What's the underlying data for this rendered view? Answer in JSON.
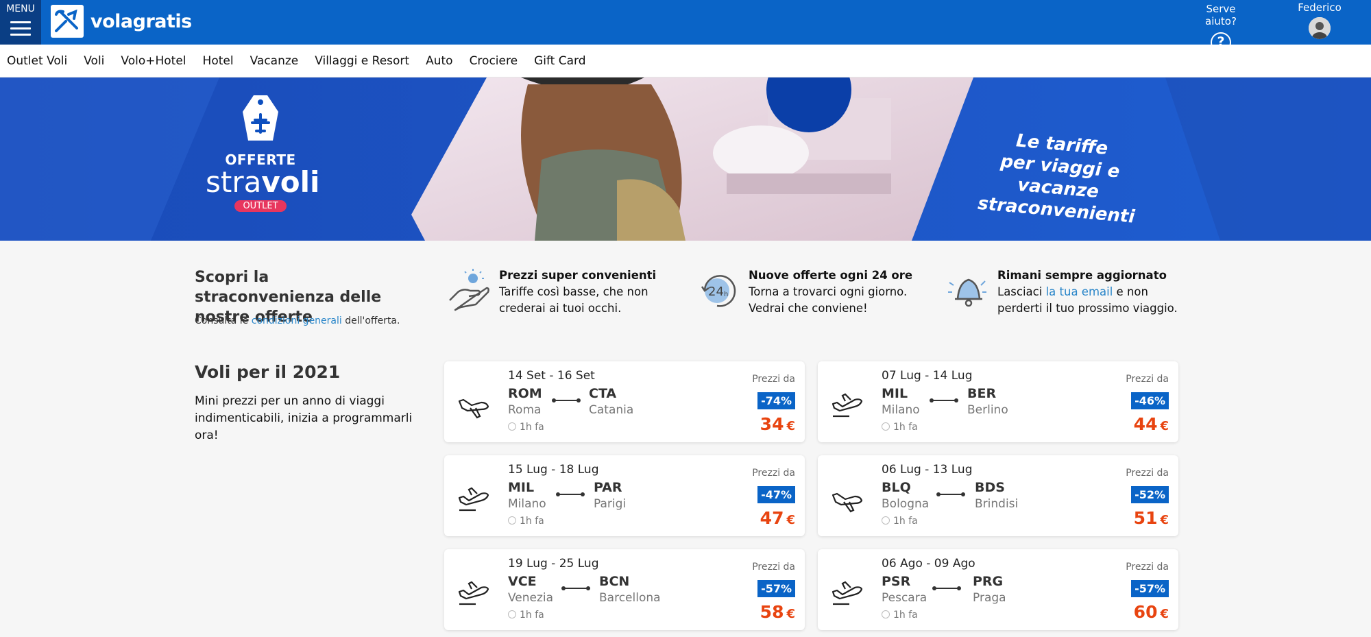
{
  "header": {
    "menu_label": "MENU",
    "brand": "volagratis",
    "help_label": "Serve aiuto?",
    "help_glyph": "?",
    "user_name": "Federico",
    "colors": {
      "primary": "#0a64c7",
      "dark": "#0a3e84",
      "price": "#e84410",
      "link": "#2a86c9"
    }
  },
  "nav": {
    "items": [
      "Outlet Voli",
      "Voli",
      "Volo+Hotel",
      "Hotel",
      "Vacanze",
      "Villaggi e Resort",
      "Auto",
      "Crociere",
      "Gift Card"
    ]
  },
  "banner": {
    "offerte": "OFFERTE",
    "strav_light": "stra",
    "strav_bold": "voli",
    "pill": "OUTLET",
    "slogan_1": "Le tariffe",
    "slogan_2": "per viaggi e vacanze",
    "slogan_3": "straconvenienti"
  },
  "intro": {
    "title": "Scopri la straconvenienza delle nostre offerte",
    "sub_prefix": "Consulta le ",
    "sub_link": "condizioni generali",
    "sub_suffix": " dell'offerta."
  },
  "features": [
    {
      "icon": "hand-tag-icon",
      "title": "Prezzi super convenienti",
      "line1": "Tariffe così basse, che non",
      "line2": "crederai ai tuoi occhi."
    },
    {
      "icon": "24h-icon",
      "title": "Nuove offerte ogni 24 ore",
      "line1": "Torna a trovarci ogni giorno.",
      "line2": "Vedrai che conviene!"
    },
    {
      "icon": "bell-icon",
      "title": "Rimani sempre aggiornato",
      "line1_prefix": "Lasciaci ",
      "line1_link": "la tua email",
      "line1_suffix": " e non",
      "line2": "perderti il tuo prossimo viaggio."
    }
  ],
  "flights": {
    "title": "Voli per il 2021",
    "subtitle": "Mini prezzi per un anno di viaggi indimenticabili, inizia a programmarli ora!",
    "price_label": "Prezzi da",
    "currency": "€",
    "cards": [
      {
        "dates": "14 Set - 16 Set",
        "from_code": "ROM",
        "from_city": "Roma",
        "to_code": "CTA",
        "to_city": "Catania",
        "ago": "1h fa",
        "discount": "-74%",
        "price": "34"
      },
      {
        "dates": "07 Lug - 14 Lug",
        "from_code": "MIL",
        "from_city": "Milano",
        "to_code": "BER",
        "to_city": "Berlino",
        "ago": "1h fa",
        "discount": "-46%",
        "price": "44"
      },
      {
        "dates": "15 Lug - 18 Lug",
        "from_code": "MIL",
        "from_city": "Milano",
        "to_code": "PAR",
        "to_city": "Parigi",
        "ago": "1h fa",
        "discount": "-47%",
        "price": "47"
      },
      {
        "dates": "06 Lug - 13 Lug",
        "from_code": "BLQ",
        "from_city": "Bologna",
        "to_code": "BDS",
        "to_city": "Brindisi",
        "ago": "1h fa",
        "discount": "-52%",
        "price": "51"
      },
      {
        "dates": "19 Lug - 25 Lug",
        "from_code": "VCE",
        "from_city": "Venezia",
        "to_code": "BCN",
        "to_city": "Barcellona",
        "ago": "1h fa",
        "discount": "-57%",
        "price": "58"
      },
      {
        "dates": "06 Ago - 09 Ago",
        "from_code": "PSR",
        "from_city": "Pescara",
        "to_code": "PRG",
        "to_city": "Praga",
        "ago": "1h fa",
        "discount": "-57%",
        "price": "60"
      }
    ]
  }
}
